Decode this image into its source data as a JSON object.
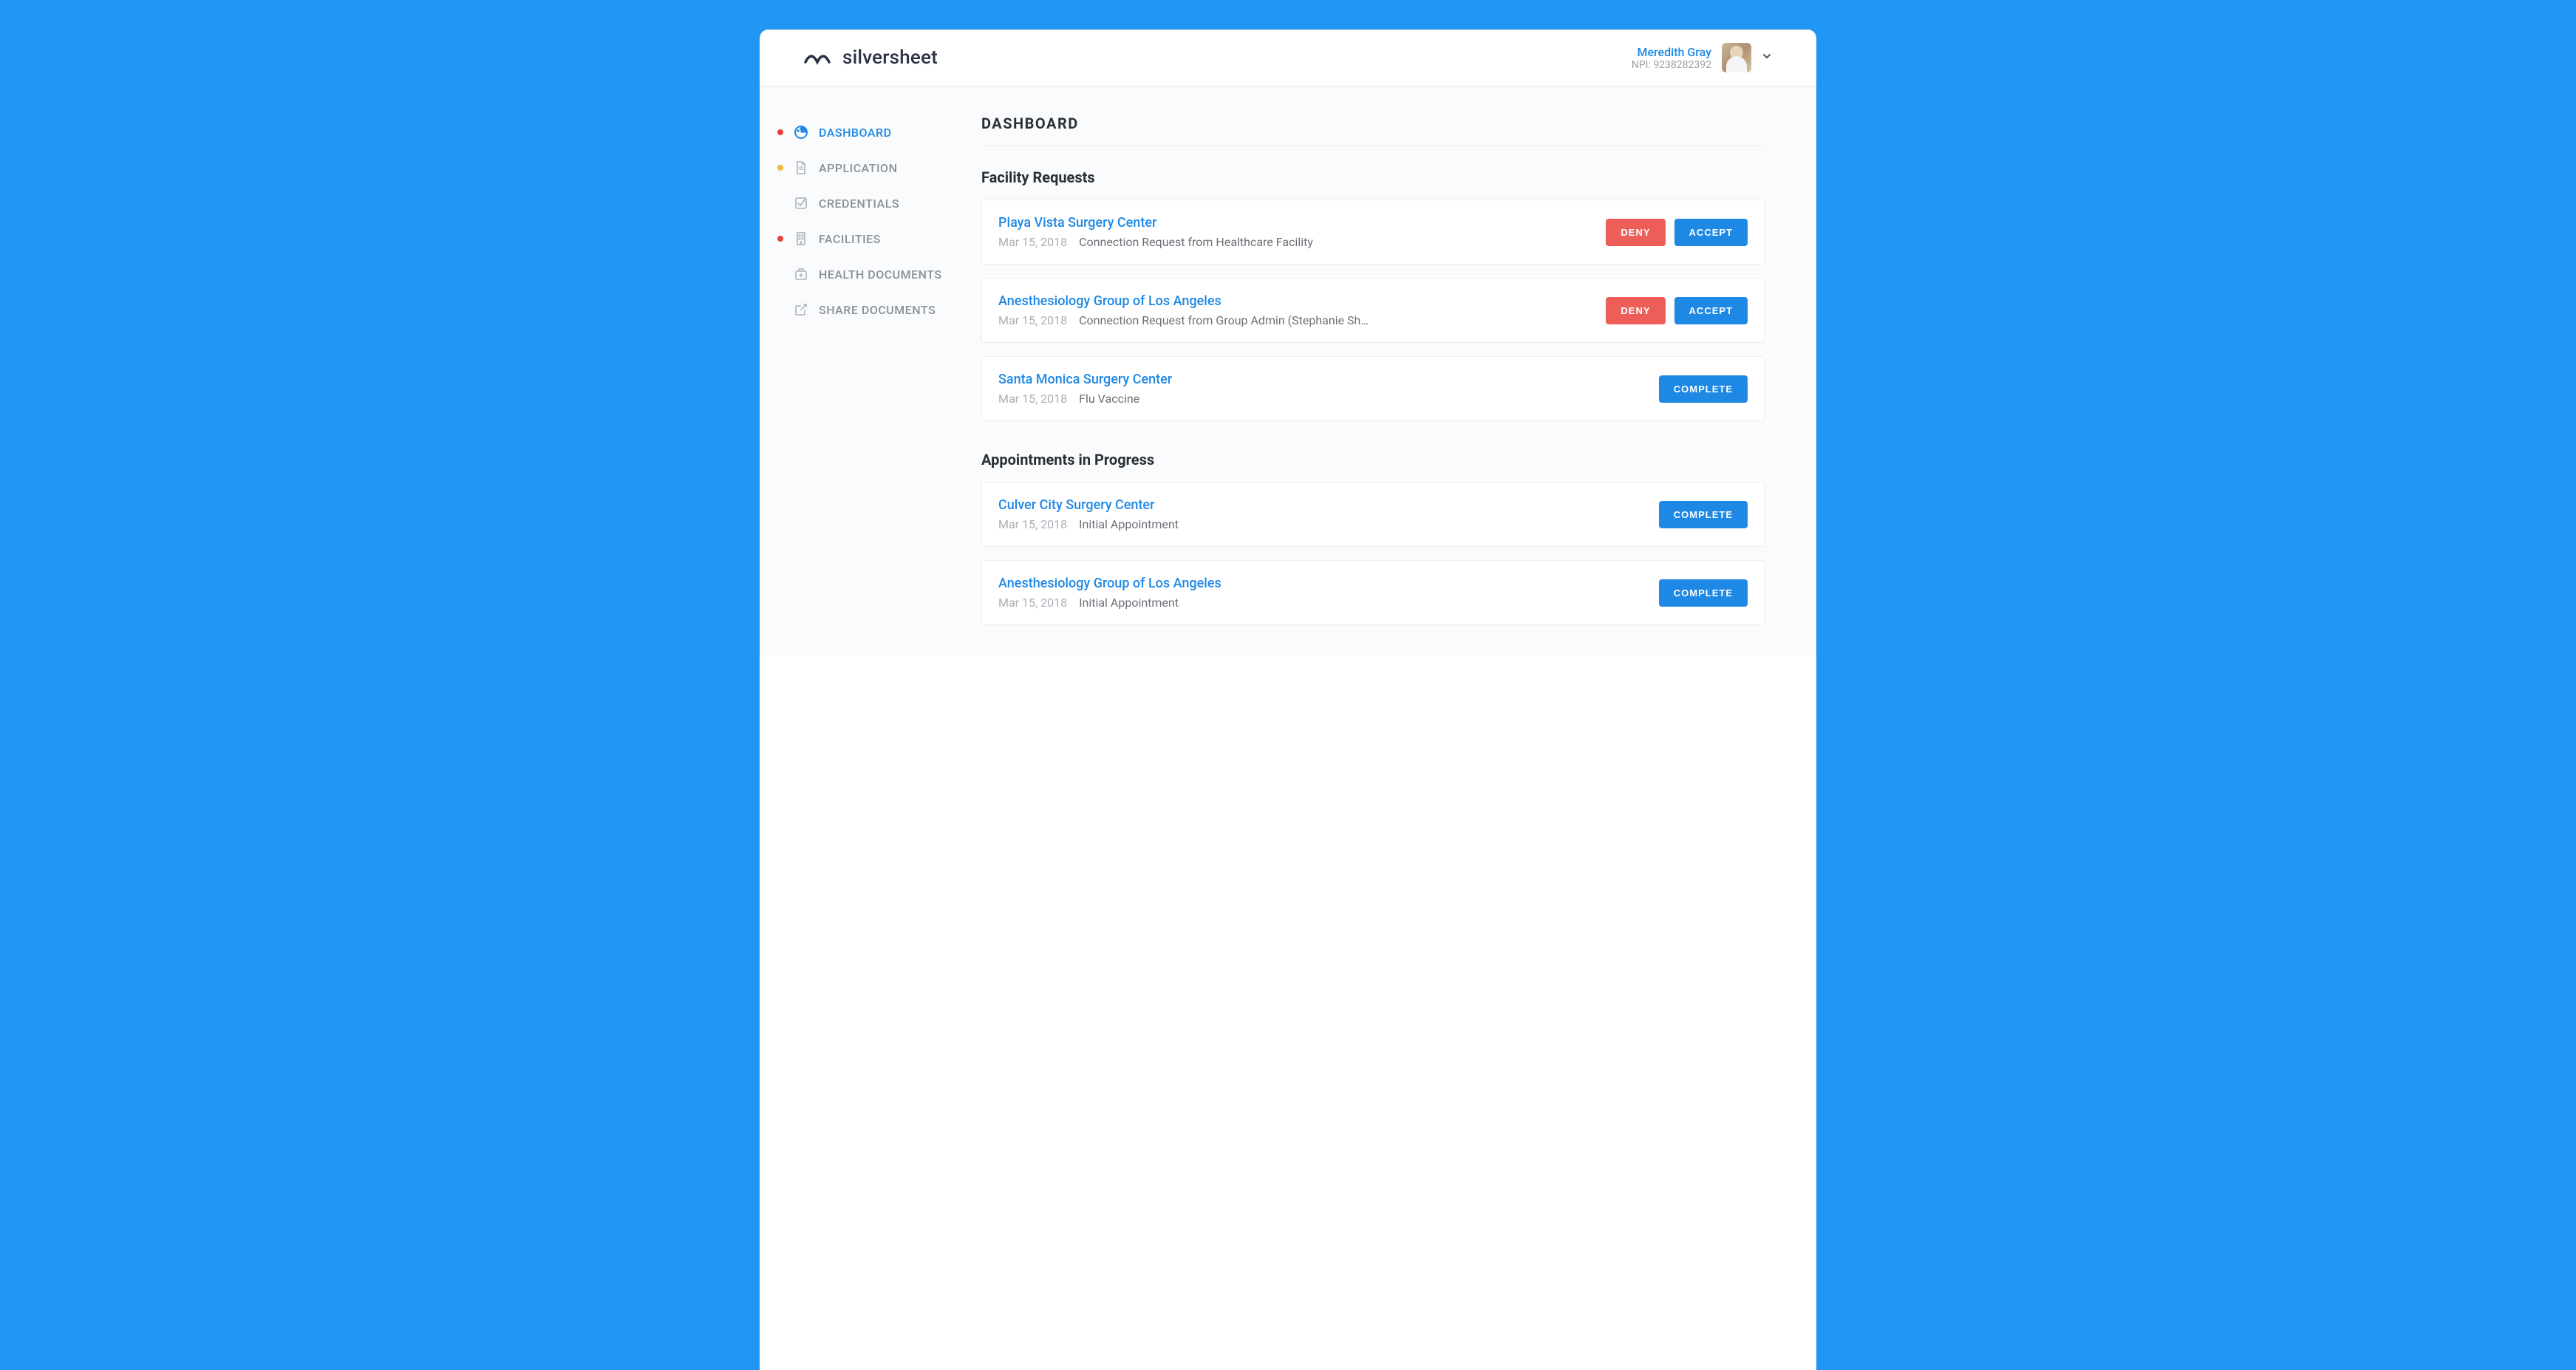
{
  "brand": {
    "name": "silversheet"
  },
  "user": {
    "name": "Meredith Gray",
    "npi_label": "NPI: 9238282392"
  },
  "sidebar": {
    "items": [
      {
        "label": "DASHBOARD"
      },
      {
        "label": "APPLICATION"
      },
      {
        "label": "CREDENTIALS"
      },
      {
        "label": "FACILITIES"
      },
      {
        "label": "HEALTH DOCUMENTS"
      },
      {
        "label": "SHARE DOCUMENTS"
      }
    ]
  },
  "page": {
    "title": "DASHBOARD"
  },
  "sections": {
    "facility_requests": {
      "title": "Facility Requests",
      "items": [
        {
          "title": "Playa Vista Surgery Center",
          "date": "Mar 15, 2018",
          "desc": "Connection Request from Healthcare Facility",
          "deny": "DENY",
          "accept": "ACCEPT"
        },
        {
          "title": "Anesthesiology Group of Los Angeles",
          "date": "Mar 15, 2018",
          "desc": "Connection Request from Group Admin (Stephanie Sh…",
          "deny": "DENY",
          "accept": "ACCEPT"
        },
        {
          "title": "Santa Monica Surgery Center",
          "date": "Mar 15, 2018",
          "desc": "Flu Vaccine",
          "complete": "COMPLETE"
        }
      ]
    },
    "appointments": {
      "title": "Appointments in Progress",
      "items": [
        {
          "title": "Culver City Surgery Center",
          "date": "Mar 15, 2018",
          "desc": "Initial Appointment",
          "complete": "COMPLETE"
        },
        {
          "title": "Anesthesiology Group of Los Angeles",
          "date": "Mar 15, 2018",
          "desc": "Initial Appointment",
          "complete": "COMPLETE"
        }
      ]
    }
  }
}
